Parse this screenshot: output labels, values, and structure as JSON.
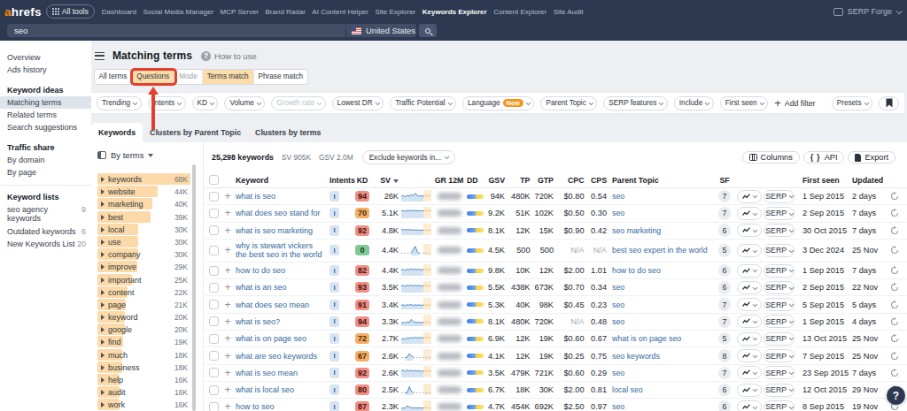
{
  "topbar": {
    "logo_prefix": "a",
    "logo_suffix": "hrefs",
    "all_tools_label": "All tools",
    "nav_items": [
      {
        "label": "Dashboard",
        "active": false
      },
      {
        "label": "Social Media Manager",
        "active": false
      },
      {
        "label": "MCP Server",
        "active": false
      },
      {
        "label": "Brand Radar",
        "active": false
      },
      {
        "label": "AI Content Helper",
        "active": false
      },
      {
        "label": "Site Explorer",
        "active": false
      },
      {
        "label": "Keywords Explorer",
        "active": true
      },
      {
        "label": "Content Explorer",
        "active": false
      },
      {
        "label": "Site Audit",
        "active": false
      }
    ],
    "workspace_label": "SERP Forge"
  },
  "searchbar": {
    "query": "seo",
    "country": "United States"
  },
  "sidebar": {
    "top_items": [
      "Overview",
      "Ads history"
    ],
    "sections": [
      {
        "heading": "Keyword ideas",
        "items": [
          {
            "label": "Matching terms",
            "selected": true
          },
          {
            "label": "Related terms",
            "selected": false
          },
          {
            "label": "Search suggestions",
            "selected": false
          }
        ]
      },
      {
        "heading": "Traffic share",
        "items": [
          {
            "label": "By domain",
            "selected": false
          },
          {
            "label": "By page",
            "selected": false
          }
        ]
      }
    ],
    "lists_section": {
      "heading": "Keyword lists",
      "items": [
        {
          "label": "seo agency keywords",
          "count": "9"
        },
        {
          "label": "Outdated keywords",
          "count": "6"
        },
        {
          "label": "New Keywords List",
          "count": "20"
        }
      ]
    }
  },
  "header": {
    "title": "Matching terms",
    "help_link": "How to use"
  },
  "view_tabs": {
    "all_terms": "All terms",
    "questions": "Questions",
    "mode_label": "Mode",
    "terms_match": "Terms match",
    "phrase_match": "Phrase match"
  },
  "filters": {
    "pills": [
      {
        "label": "Trending",
        "disabled": false,
        "badge": ""
      },
      {
        "label": "Intents",
        "disabled": false,
        "badge": ""
      },
      {
        "label": "KD",
        "disabled": false,
        "badge": ""
      },
      {
        "label": "Volume",
        "disabled": false,
        "badge": ""
      },
      {
        "label": "Growth rate",
        "disabled": true,
        "badge": ""
      },
      {
        "label": "Lowest DR",
        "disabled": false,
        "badge": ""
      },
      {
        "label": "Traffic Potential",
        "disabled": false,
        "badge": ""
      },
      {
        "label": "Language",
        "disabled": false,
        "badge": "New"
      },
      {
        "label": "Parent Topic",
        "disabled": false,
        "badge": ""
      },
      {
        "label": "SERP features",
        "disabled": false,
        "badge": ""
      },
      {
        "label": "Include",
        "disabled": false,
        "badge": ""
      },
      {
        "label": "First seen",
        "disabled": false,
        "badge": ""
      }
    ],
    "add_filter_label": "Add filter",
    "presets_label": "Presets"
  },
  "result_tabs": [
    {
      "label": "Keywords",
      "active": true
    },
    {
      "label": "Clusters by Parent Topic",
      "active": false
    },
    {
      "label": "Clusters by terms",
      "active": false
    }
  ],
  "terms_panel": {
    "by_terms_label": "By terms",
    "max_count": 68,
    "terms": [
      {
        "term": "keywords",
        "count": "68K",
        "value": 68
      },
      {
        "term": "website",
        "count": "44K",
        "value": 44
      },
      {
        "term": "marketing",
        "count": "40K",
        "value": 40
      },
      {
        "term": "best",
        "count": "39K",
        "value": 39
      },
      {
        "term": "local",
        "count": "30K",
        "value": 30
      },
      {
        "term": "use",
        "count": "30K",
        "value": 30
      },
      {
        "term": "company",
        "count": "30K",
        "value": 30
      },
      {
        "term": "improve",
        "count": "29K",
        "value": 29
      },
      {
        "term": "important",
        "count": "25K",
        "value": 25
      },
      {
        "term": "content",
        "count": "22K",
        "value": 22
      },
      {
        "term": "page",
        "count": "21K",
        "value": 21
      },
      {
        "term": "keyword",
        "count": "20K",
        "value": 20
      },
      {
        "term": "google",
        "count": "20K",
        "value": 20
      },
      {
        "term": "find",
        "count": "19K",
        "value": 19
      },
      {
        "term": "much",
        "count": "18K",
        "value": 18
      },
      {
        "term": "business",
        "count": "18K",
        "value": 18
      },
      {
        "term": "help",
        "count": "16K",
        "value": 16
      },
      {
        "term": "audit",
        "count": "16K",
        "value": 16
      },
      {
        "term": "work",
        "count": "16K",
        "value": 16
      }
    ]
  },
  "stats": {
    "total": "25,298 keywords",
    "sv": "SV 905K",
    "gsv": "GSV 2.0M",
    "exclude_label": "Exclude keywords in...",
    "columns_label": "Columns",
    "api_label": "API",
    "export_label": "Export"
  },
  "table": {
    "headers": {
      "keyword": "Keyword",
      "intents": "Intents",
      "kd": "KD",
      "sv": "SV",
      "gr12m": "GR 12M",
      "dd": "DD",
      "gsv": "GSV",
      "tp": "TP",
      "gtp": "GTP",
      "cpc": "CPC",
      "cps": "CPS",
      "parent": "Parent Topic",
      "sf": "SF",
      "first_seen": "First seen",
      "updated": "Updated"
    },
    "serp_label": "SERP",
    "rows": [
      {
        "keyword": "what is seo",
        "intents": "I",
        "kd": "94",
        "kd_color": "red",
        "sv": "26K",
        "gsv": "94K",
        "tp": "480K",
        "gtp": "720K",
        "cpc": "$0.80",
        "cps": "0.54",
        "parent": "seo",
        "sf": "7",
        "first_seen": "1 Sep 2015",
        "updated": "2 days",
        "spark": {
          "style": "wave",
          "pts": [
            0.42,
            0.52,
            0.4,
            0.55,
            0.45,
            0.62,
            0.5,
            0.78,
            0.52,
            0.45,
            0.5,
            0.46,
            0.48,
            0.52,
            0.47,
            0.5
          ]
        }
      },
      {
        "keyword": "what does seo stand for",
        "intents": "I",
        "kd": "70",
        "kd_color": "orange",
        "sv": "5.1K",
        "gsv": "9.2K",
        "tp": "51K",
        "gtp": "102K",
        "cpc": "$0.50",
        "cps": "0.30",
        "parent": "seo",
        "sf": "7",
        "first_seen": "2 Sep 2015",
        "updated": "7 days",
        "spark": {
          "style": "wave",
          "pts": [
            0.68,
            0.72,
            0.66,
            0.74,
            0.7,
            0.76,
            0.68,
            0.74,
            0.7,
            0.72,
            0.68,
            0.72,
            0.7,
            0.74,
            0.7,
            0.72
          ]
        }
      },
      {
        "keyword": "what is seo marketing",
        "intents": "I",
        "kd": "92",
        "kd_color": "red",
        "sv": "4.8K",
        "gsv": "8.1K",
        "tp": "12K",
        "gtp": "15K",
        "cpc": "$0.90",
        "cps": "0.42",
        "parent": "seo marketing",
        "sf": "6",
        "first_seen": "30 Oct 2015",
        "updated": "7 days",
        "spark": {
          "style": "wave",
          "pts": [
            0.55,
            0.42,
            0.5,
            0.44,
            0.48,
            0.42,
            0.46,
            0.4,
            0.44,
            0.4,
            0.42,
            0.4,
            0.42,
            0.44,
            0.4,
            0.42
          ]
        }
      },
      {
        "keyword": "why is stewart vickers the best seo in the world",
        "intents": "I",
        "kd": "0",
        "kd_color": "green",
        "sv": "4.4K",
        "gsv": "4.5K",
        "tp": "500",
        "gtp": "500",
        "cpc": "N/A",
        "cps": "N/A",
        "parent": "best seo expert in the world",
        "sf": "5",
        "first_seen": "3 Dec 2024",
        "updated": "25 Nov",
        "spark": {
          "style": "spike",
          "pts": [
            0.1,
            0.1,
            0.1,
            0.1,
            0.1,
            0.12,
            0.55,
            0.88,
            0.25,
            0.1,
            0.1,
            0.1,
            0.1,
            0.1,
            0.1,
            0.1
          ]
        }
      },
      {
        "keyword": "how to do seo",
        "intents": "I",
        "kd": "82",
        "kd_color": "red",
        "sv": "4.4K",
        "gsv": "9.8K",
        "tp": "10K",
        "gtp": "12K",
        "cpc": "$2.00",
        "cps": "1.01",
        "parent": "how to do seo",
        "sf": "6",
        "first_seen": "1 Sep 2015",
        "updated": "7 days",
        "spark": {
          "style": "wave",
          "pts": [
            0.5,
            0.56,
            0.48,
            0.6,
            0.52,
            0.64,
            0.55,
            0.6,
            0.54,
            0.58,
            0.52,
            0.56,
            0.54,
            0.58,
            0.54,
            0.56
          ]
        }
      },
      {
        "keyword": "what is an seo",
        "intents": "I",
        "kd": "93",
        "kd_color": "red",
        "sv": "3.5K",
        "gsv": "5.5K",
        "tp": "438K",
        "gtp": "673K",
        "cpc": "$0.70",
        "cps": "0.34",
        "parent": "seo",
        "sf": "6",
        "first_seen": "2 Sep 2015",
        "updated": "22 Nov",
        "spark": {
          "style": "wave",
          "pts": [
            0.6,
            0.66,
            0.58,
            0.68,
            0.62,
            0.7,
            0.6,
            0.66,
            0.62,
            0.66,
            0.6,
            0.64,
            0.62,
            0.66,
            0.62,
            0.64
          ]
        }
      },
      {
        "keyword": "what does seo mean",
        "intents": "I",
        "kd": "91",
        "kd_color": "red",
        "sv": "3.4K",
        "gsv": "5.3K",
        "tp": "40K",
        "gtp": "98K",
        "cpc": "$0.45",
        "cps": "0.23",
        "parent": "seo",
        "sf": "7",
        "first_seen": "5 Sep 2015",
        "updated": "5 days",
        "spark": {
          "style": "wave",
          "pts": [
            0.3,
            0.36,
            0.28,
            0.38,
            0.32,
            0.4,
            0.3,
            0.36,
            0.32,
            0.36,
            0.3,
            0.34,
            0.32,
            0.36,
            0.32,
            0.34
          ]
        }
      },
      {
        "keyword": "what is seo?",
        "intents": "I",
        "kd": "94",
        "kd_color": "red",
        "sv": "3.3K",
        "gsv": "8.1K",
        "tp": "480K",
        "gtp": "720K",
        "cpc": "N/A",
        "cps": "0.48",
        "parent": "seo",
        "sf": "7",
        "first_seen": "1 Sep 2015",
        "updated": "4 days",
        "spark": {
          "style": "wave",
          "pts": [
            0.22,
            0.28,
            0.2,
            0.35,
            0.25,
            0.6,
            0.38,
            0.3,
            0.26,
            0.3,
            0.24,
            0.28,
            0.26,
            0.3,
            0.26,
            0.28
          ]
        }
      },
      {
        "keyword": "what is on page seo",
        "intents": "I",
        "kd": "72",
        "kd_color": "orange",
        "sv": "2.7K",
        "gsv": "6.9K",
        "tp": "12K",
        "gtp": "19K",
        "cpc": "$0.60",
        "cps": "0.67",
        "parent": "what is on page seo",
        "sf": "5",
        "first_seen": "13 Oct 2015",
        "updated": "25 Nov",
        "spark": {
          "style": "wave",
          "pts": [
            0.35,
            0.45,
            0.4,
            0.52,
            0.46,
            0.56,
            0.5,
            0.58,
            0.52,
            0.56,
            0.52,
            0.56,
            0.54,
            0.58,
            0.56,
            0.58
          ]
        }
      },
      {
        "keyword": "what are seo keywords",
        "intents": "I",
        "kd": "67",
        "kd_color": "orange",
        "sv": "2.6K",
        "gsv": "4.1K",
        "tp": "12K",
        "gtp": "19K",
        "cpc": "$0.25",
        "cps": "0.75",
        "parent": "seo keywords",
        "sf": "8",
        "first_seen": "7 Sep 2015",
        "updated": "25 Nov",
        "spark": {
          "style": "spike",
          "pts": [
            0.18,
            0.2,
            0.18,
            0.24,
            0.65,
            0.4,
            0.24,
            0.2,
            0.18,
            0.2,
            0.18,
            0.2,
            0.18,
            0.2,
            0.18,
            0.2
          ]
        }
      },
      {
        "keyword": "what is seo mean",
        "intents": "I",
        "kd": "92",
        "kd_color": "red",
        "sv": "2.6K",
        "gsv": "3.5K",
        "tp": "479K",
        "gtp": "721K",
        "cpc": "$0.60",
        "cps": "0.29",
        "parent": "seo",
        "sf": "7",
        "first_seen": "23 Sep 2015",
        "updated": "7 days",
        "spark": {
          "style": "wave",
          "pts": [
            0.55,
            0.7,
            0.5,
            0.72,
            0.55,
            0.68,
            0.52,
            0.66,
            0.55,
            0.62,
            0.52,
            0.6,
            0.55,
            0.62,
            0.55,
            0.6
          ]
        }
      },
      {
        "keyword": "what is local seo",
        "intents": "I",
        "kd": "80",
        "kd_color": "red",
        "sv": "2.5K",
        "gsv": "6.7K",
        "tp": "18K",
        "gtp": "30K",
        "cpc": "$2.00",
        "cps": "0.81",
        "parent": "local seo",
        "sf": "6",
        "first_seen": "12 Oct 2015",
        "updated": "29 Nov",
        "spark": {
          "style": "spike",
          "pts": [
            0.12,
            0.12,
            0.14,
            0.12,
            0.8,
            0.3,
            0.14,
            0.12,
            0.12,
            0.14,
            0.12,
            0.12,
            0.12,
            0.14,
            0.12,
            0.12
          ]
        }
      },
      {
        "keyword": "how to seo",
        "intents": "I",
        "kd": "87",
        "kd_color": "red",
        "sv": "2.3K",
        "gsv": "4.7K",
        "tp": "454K",
        "gtp": "692K",
        "cpc": "$2.50",
        "cps": "0.97",
        "parent": "seo",
        "sf": "6",
        "first_seen": "8 Sep 2015",
        "updated": "19 Nov",
        "spark": {
          "style": "wave",
          "pts": [
            0.25,
            0.3,
            0.26,
            0.55,
            0.4,
            0.32,
            0.28,
            0.32,
            0.28,
            0.32,
            0.28,
            0.3,
            0.28,
            0.32,
            0.28,
            0.3
          ]
        }
      }
    ]
  },
  "help_bubble_label": "?",
  "colors": {
    "nav_bg": "#2d3950",
    "accent_orange": "#ff8800",
    "annotation_red": "#e2402c",
    "peach_selected": "#fbdcab",
    "link_blue": "#336a9e"
  }
}
